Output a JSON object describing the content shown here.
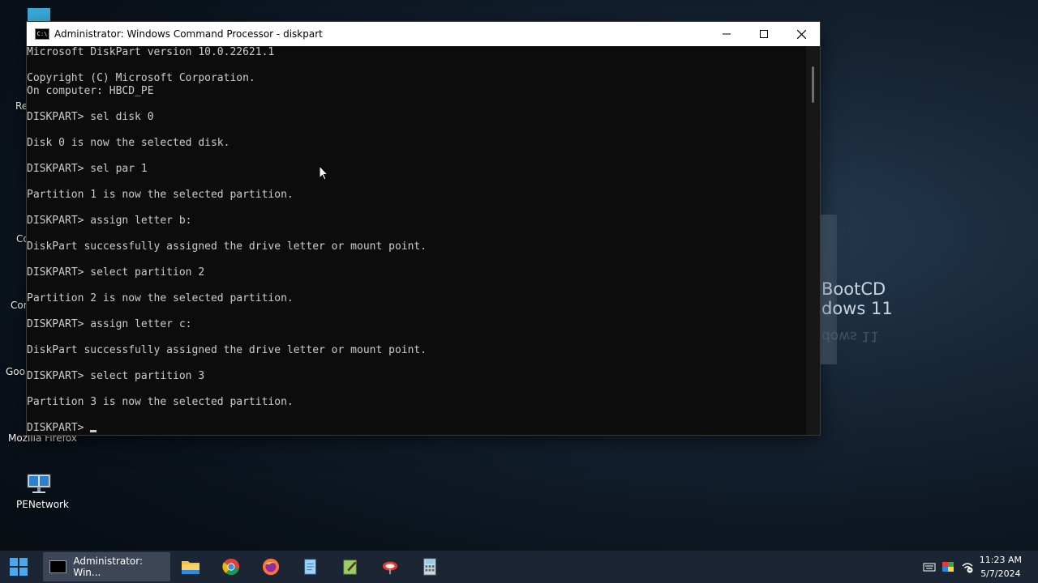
{
  "desktop": {
    "icons": [
      {
        "label": "Mozilla Firefox"
      },
      {
        "label": "PENetwork"
      }
    ],
    "partial_labels": [
      "Re",
      "Co",
      "Con",
      "Goo"
    ],
    "brand_lines": [
      "BootCD",
      "dows 11"
    ]
  },
  "window": {
    "title": "Administrator: Windows Command Processor - diskpart",
    "icon_text": "C:\\",
    "console_lines": [
      "Microsoft DiskPart version 10.0.22621.1",
      "",
      "Copyright (C) Microsoft Corporation.",
      "On computer: HBCD_PE",
      "",
      "DISKPART> sel disk 0",
      "",
      "Disk 0 is now the selected disk.",
      "",
      "DISKPART> sel par 1",
      "",
      "Partition 1 is now the selected partition.",
      "",
      "DISKPART> assign letter b:",
      "",
      "DiskPart successfully assigned the drive letter or mount point.",
      "",
      "DISKPART> select partition 2",
      "",
      "Partition 2 is now the selected partition.",
      "",
      "DISKPART> assign letter c:",
      "",
      "DiskPart successfully assigned the drive letter or mount point.",
      "",
      "DISKPART> select partition 3",
      "",
      "Partition 3 is now the selected partition.",
      "",
      "DISKPART> "
    ]
  },
  "taskbar": {
    "active_app_label": "Administrator: Win...",
    "pinned": [
      "start-icon",
      "file-explorer-icon",
      "chrome-icon",
      "firefox-icon",
      "notepad-icon",
      "notepadpp-icon",
      "network-tool-icon",
      "calculator-icon"
    ],
    "clock_time": "11:23 AM",
    "clock_date": "5/7/2024"
  },
  "colors": {
    "console_bg": "#0c0c0c",
    "console_fg": "#cccccc",
    "taskbar_bg": "#1c2533"
  }
}
